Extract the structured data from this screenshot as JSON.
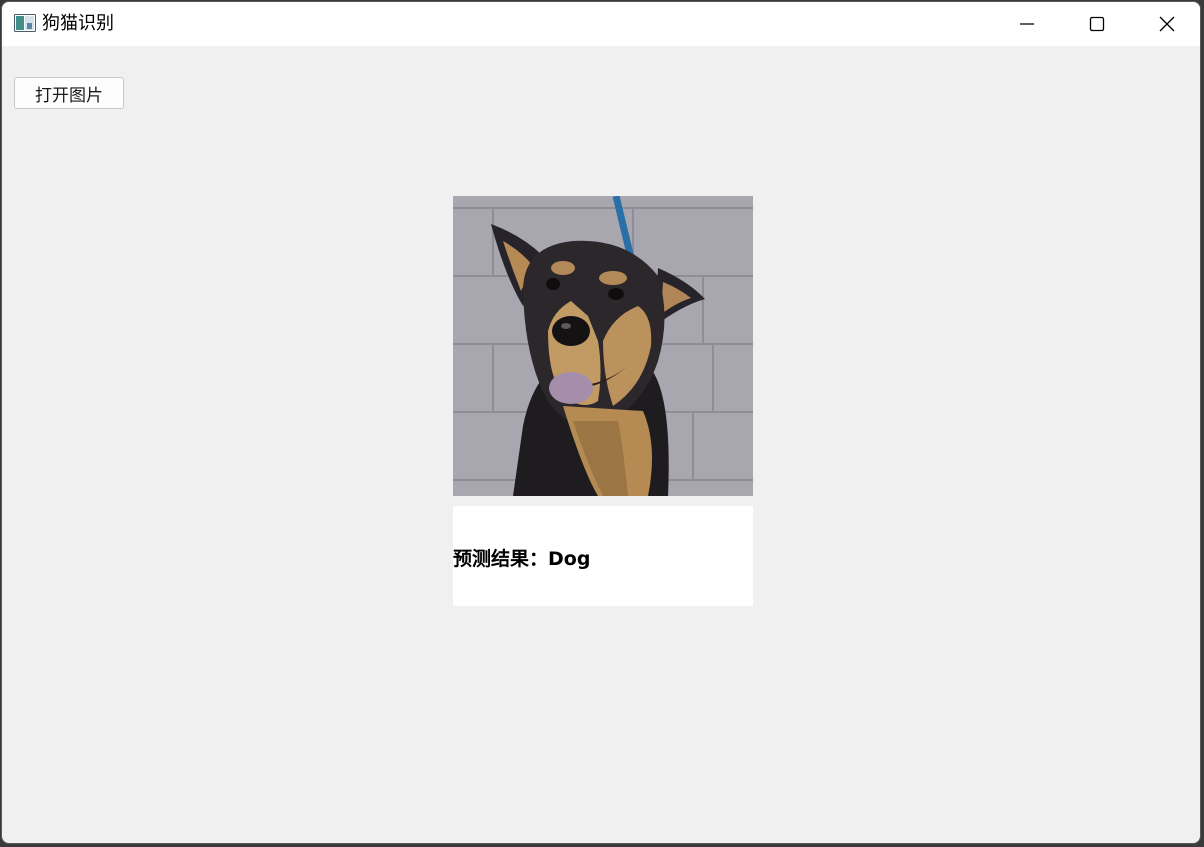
{
  "window": {
    "title": "狗猫识别",
    "controls": {
      "minimize_icon": "minimize-icon",
      "maximize_icon": "maximize-icon",
      "close_icon": "close-icon"
    }
  },
  "toolbar": {
    "open_image_label": "打开图片"
  },
  "image_panel": {
    "subject": "dog",
    "icon": "dog-photo"
  },
  "result": {
    "label": "预测结果：",
    "value": "Dog"
  },
  "colors": {
    "window_background": "#f0f0f0",
    "titlebar_background": "#ffffff",
    "result_background": "#ffffff"
  }
}
